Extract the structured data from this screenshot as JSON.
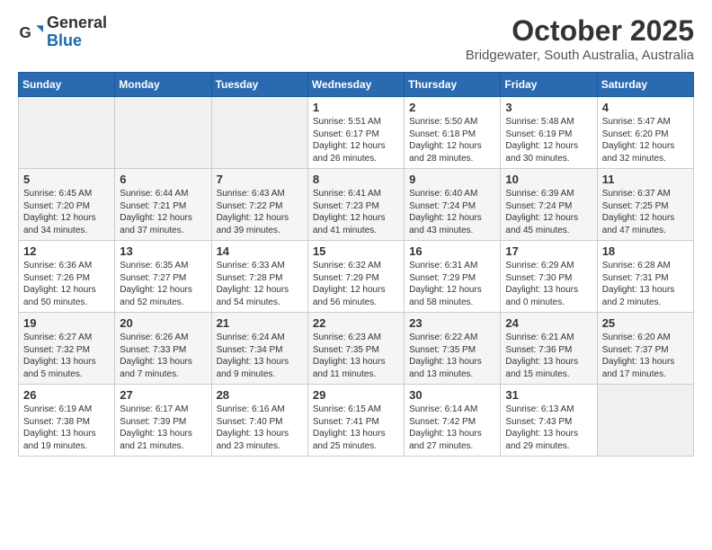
{
  "logo": {
    "general": "General",
    "blue": "Blue"
  },
  "header": {
    "title": "October 2025",
    "subtitle": "Bridgewater, South Australia, Australia"
  },
  "weekdays": [
    "Sunday",
    "Monday",
    "Tuesday",
    "Wednesday",
    "Thursday",
    "Friday",
    "Saturday"
  ],
  "weeks": [
    [
      {
        "day": "",
        "info": ""
      },
      {
        "day": "",
        "info": ""
      },
      {
        "day": "",
        "info": ""
      },
      {
        "day": "1",
        "info": "Sunrise: 5:51 AM\nSunset: 6:17 PM\nDaylight: 12 hours\nand 26 minutes."
      },
      {
        "day": "2",
        "info": "Sunrise: 5:50 AM\nSunset: 6:18 PM\nDaylight: 12 hours\nand 28 minutes."
      },
      {
        "day": "3",
        "info": "Sunrise: 5:48 AM\nSunset: 6:19 PM\nDaylight: 12 hours\nand 30 minutes."
      },
      {
        "day": "4",
        "info": "Sunrise: 5:47 AM\nSunset: 6:20 PM\nDaylight: 12 hours\nand 32 minutes."
      }
    ],
    [
      {
        "day": "5",
        "info": "Sunrise: 6:45 AM\nSunset: 7:20 PM\nDaylight: 12 hours\nand 34 minutes."
      },
      {
        "day": "6",
        "info": "Sunrise: 6:44 AM\nSunset: 7:21 PM\nDaylight: 12 hours\nand 37 minutes."
      },
      {
        "day": "7",
        "info": "Sunrise: 6:43 AM\nSunset: 7:22 PM\nDaylight: 12 hours\nand 39 minutes."
      },
      {
        "day": "8",
        "info": "Sunrise: 6:41 AM\nSunset: 7:23 PM\nDaylight: 12 hours\nand 41 minutes."
      },
      {
        "day": "9",
        "info": "Sunrise: 6:40 AM\nSunset: 7:24 PM\nDaylight: 12 hours\nand 43 minutes."
      },
      {
        "day": "10",
        "info": "Sunrise: 6:39 AM\nSunset: 7:24 PM\nDaylight: 12 hours\nand 45 minutes."
      },
      {
        "day": "11",
        "info": "Sunrise: 6:37 AM\nSunset: 7:25 PM\nDaylight: 12 hours\nand 47 minutes."
      }
    ],
    [
      {
        "day": "12",
        "info": "Sunrise: 6:36 AM\nSunset: 7:26 PM\nDaylight: 12 hours\nand 50 minutes."
      },
      {
        "day": "13",
        "info": "Sunrise: 6:35 AM\nSunset: 7:27 PM\nDaylight: 12 hours\nand 52 minutes."
      },
      {
        "day": "14",
        "info": "Sunrise: 6:33 AM\nSunset: 7:28 PM\nDaylight: 12 hours\nand 54 minutes."
      },
      {
        "day": "15",
        "info": "Sunrise: 6:32 AM\nSunset: 7:29 PM\nDaylight: 12 hours\nand 56 minutes."
      },
      {
        "day": "16",
        "info": "Sunrise: 6:31 AM\nSunset: 7:29 PM\nDaylight: 12 hours\nand 58 minutes."
      },
      {
        "day": "17",
        "info": "Sunrise: 6:29 AM\nSunset: 7:30 PM\nDaylight: 13 hours\nand 0 minutes."
      },
      {
        "day": "18",
        "info": "Sunrise: 6:28 AM\nSunset: 7:31 PM\nDaylight: 13 hours\nand 2 minutes."
      }
    ],
    [
      {
        "day": "19",
        "info": "Sunrise: 6:27 AM\nSunset: 7:32 PM\nDaylight: 13 hours\nand 5 minutes."
      },
      {
        "day": "20",
        "info": "Sunrise: 6:26 AM\nSunset: 7:33 PM\nDaylight: 13 hours\nand 7 minutes."
      },
      {
        "day": "21",
        "info": "Sunrise: 6:24 AM\nSunset: 7:34 PM\nDaylight: 13 hours\nand 9 minutes."
      },
      {
        "day": "22",
        "info": "Sunrise: 6:23 AM\nSunset: 7:35 PM\nDaylight: 13 hours\nand 11 minutes."
      },
      {
        "day": "23",
        "info": "Sunrise: 6:22 AM\nSunset: 7:35 PM\nDaylight: 13 hours\nand 13 minutes."
      },
      {
        "day": "24",
        "info": "Sunrise: 6:21 AM\nSunset: 7:36 PM\nDaylight: 13 hours\nand 15 minutes."
      },
      {
        "day": "25",
        "info": "Sunrise: 6:20 AM\nSunset: 7:37 PM\nDaylight: 13 hours\nand 17 minutes."
      }
    ],
    [
      {
        "day": "26",
        "info": "Sunrise: 6:19 AM\nSunset: 7:38 PM\nDaylight: 13 hours\nand 19 minutes."
      },
      {
        "day": "27",
        "info": "Sunrise: 6:17 AM\nSunset: 7:39 PM\nDaylight: 13 hours\nand 21 minutes."
      },
      {
        "day": "28",
        "info": "Sunrise: 6:16 AM\nSunset: 7:40 PM\nDaylight: 13 hours\nand 23 minutes."
      },
      {
        "day": "29",
        "info": "Sunrise: 6:15 AM\nSunset: 7:41 PM\nDaylight: 13 hours\nand 25 minutes."
      },
      {
        "day": "30",
        "info": "Sunrise: 6:14 AM\nSunset: 7:42 PM\nDaylight: 13 hours\nand 27 minutes."
      },
      {
        "day": "31",
        "info": "Sunrise: 6:13 AM\nSunset: 7:43 PM\nDaylight: 13 hours\nand 29 minutes."
      },
      {
        "day": "",
        "info": ""
      }
    ]
  ]
}
